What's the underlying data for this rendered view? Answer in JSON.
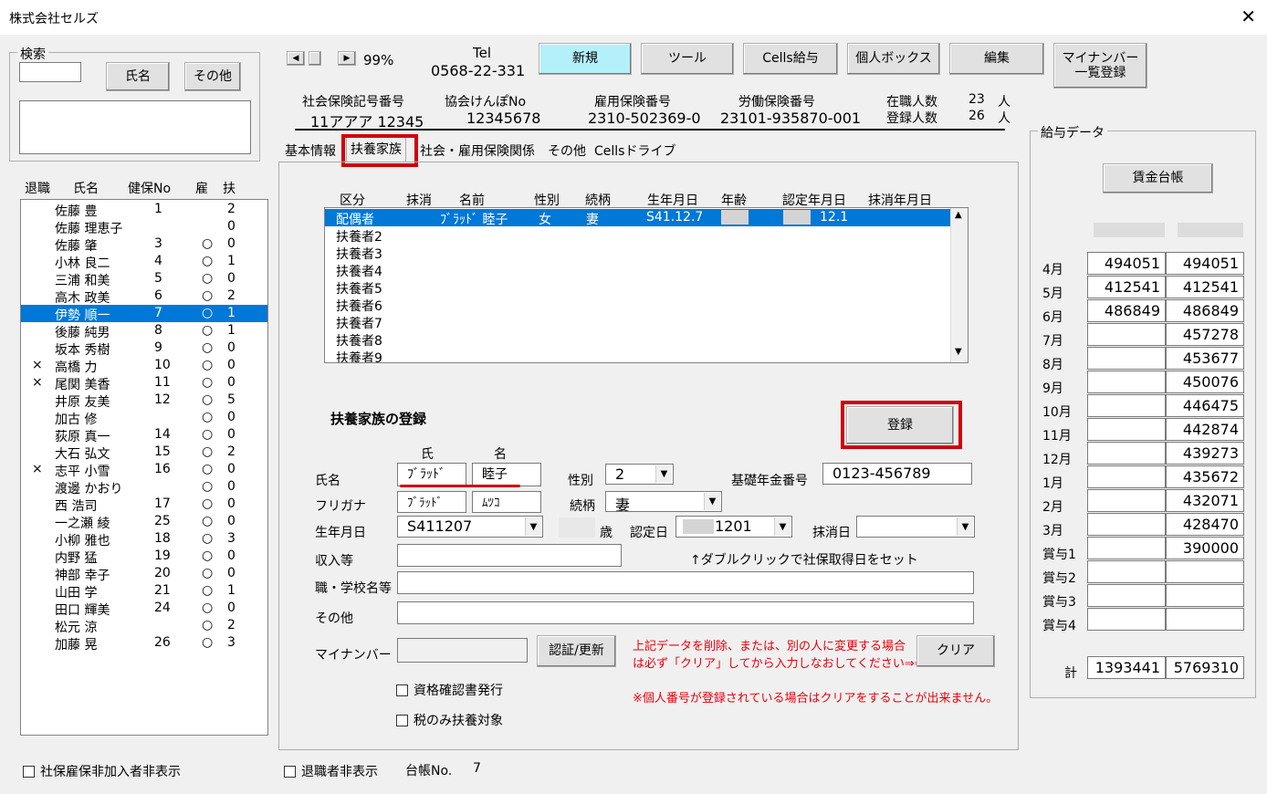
{
  "window": {
    "title": "株式会社セルズ"
  },
  "search": {
    "title": "検索",
    "name_btn": "氏名",
    "other_btn": "その他",
    "input_value": ""
  },
  "employee_list": {
    "headers": {
      "retired": "退職",
      "name": "氏名",
      "kenpo_no": "健保No",
      "employment": "雇",
      "dependents": "扶"
    },
    "rows": [
      {
        "retired": "",
        "name": "佐藤 豊",
        "kenpo_no": "1",
        "employment": "",
        "dependents": "2"
      },
      {
        "retired": "",
        "name": "佐藤 理恵子",
        "kenpo_no": "",
        "employment": "",
        "dependents": "0"
      },
      {
        "retired": "",
        "name": "佐藤 肇",
        "kenpo_no": "3",
        "employment": "○",
        "dependents": "0"
      },
      {
        "retired": "",
        "name": "小林 良二",
        "kenpo_no": "4",
        "employment": "○",
        "dependents": "1"
      },
      {
        "retired": "",
        "name": "三浦 和美",
        "kenpo_no": "5",
        "employment": "○",
        "dependents": "0"
      },
      {
        "retired": "",
        "name": "高木 政美",
        "kenpo_no": "6",
        "employment": "○",
        "dependents": "2"
      },
      {
        "retired": "",
        "name": "伊勢 順一",
        "kenpo_no": "7",
        "employment": "○",
        "dependents": "1"
      },
      {
        "retired": "",
        "name": "後藤 純男",
        "kenpo_no": "8",
        "employment": "○",
        "dependents": "1"
      },
      {
        "retired": "",
        "name": "坂本 秀樹",
        "kenpo_no": "9",
        "employment": "○",
        "dependents": "0"
      },
      {
        "retired": "×",
        "name": "高橋 力",
        "kenpo_no": "10",
        "employment": "○",
        "dependents": "0"
      },
      {
        "retired": "×",
        "name": "尾関 美香",
        "kenpo_no": "11",
        "employment": "○",
        "dependents": "0"
      },
      {
        "retired": "",
        "name": "井原 友美",
        "kenpo_no": "12",
        "employment": "○",
        "dependents": "5"
      },
      {
        "retired": "",
        "name": "加古 修",
        "kenpo_no": "",
        "employment": "○",
        "dependents": "0"
      },
      {
        "retired": "",
        "name": "荻原 真一",
        "kenpo_no": "14",
        "employment": "○",
        "dependents": "0"
      },
      {
        "retired": "",
        "name": "大石 弘文",
        "kenpo_no": "15",
        "employment": "○",
        "dependents": "2"
      },
      {
        "retired": "×",
        "name": "志平 小雪",
        "kenpo_no": "16",
        "employment": "○",
        "dependents": "0"
      },
      {
        "retired": "",
        "name": "渡邊 かおり",
        "kenpo_no": "",
        "employment": "○",
        "dependents": "0"
      },
      {
        "retired": "",
        "name": "西 浩司",
        "kenpo_no": "17",
        "employment": "○",
        "dependents": "0"
      },
      {
        "retired": "",
        "name": "一之瀬 綾",
        "kenpo_no": "25",
        "employment": "○",
        "dependents": "0"
      },
      {
        "retired": "",
        "name": "小柳 雅也",
        "kenpo_no": "18",
        "employment": "○",
        "dependents": "3"
      },
      {
        "retired": "",
        "name": "内野 猛",
        "kenpo_no": "19",
        "employment": "○",
        "dependents": "0"
      },
      {
        "retired": "",
        "name": "神部 幸子",
        "kenpo_no": "20",
        "employment": "○",
        "dependents": "0"
      },
      {
        "retired": "",
        "name": "山田 学",
        "kenpo_no": "21",
        "employment": "○",
        "dependents": "1"
      },
      {
        "retired": "",
        "name": "田口 輝美",
        "kenpo_no": "24",
        "employment": "○",
        "dependents": "0"
      },
      {
        "retired": "",
        "name": "松元 涼",
        "kenpo_no": "",
        "employment": "○",
        "dependents": "2"
      },
      {
        "retired": "",
        "name": "加藤 晃",
        "kenpo_no": "26",
        "employment": "○",
        "dependents": "3"
      }
    ],
    "selected_index": 6
  },
  "bottom": {
    "hide_uninsured": "社保雇保非加入者非表示",
    "hide_retired": "退職者非表示",
    "ledger_label": "台帳No.",
    "ledger_value": "7"
  },
  "toolbar": {
    "zoom": "99%",
    "tel_label": "Tel",
    "tel_value": "0568-22-331",
    "new_btn": "新規",
    "tool_btn": "ツール",
    "cells_kyuyo_btn": "Cells給与",
    "personal_box_btn": "個人ボックス",
    "edit_btn": "編集",
    "mynumber_btn_line1": "マイナンバー",
    "mynumber_btn_line2": "一覧登録"
  },
  "info": {
    "shaho_label": "社会保険記号番号",
    "shaho_value": "11アアア 12345",
    "kyokai_label": "協会けんぽNo",
    "kyokai_value": "12345678",
    "koyo_label": "雇用保険番号",
    "koyo_value": "2310-502369-0",
    "rodo_label": "労働保険番号",
    "rodo_value": "23101-935870-001",
    "zaishoku_label": "在職人数",
    "zaishoku_value": "23",
    "toroku_label": "登録人数",
    "toroku_value": "26",
    "unit": "人"
  },
  "tabs": [
    "基本情報",
    "扶養家族",
    "社会・雇用保険関係",
    "その他",
    "Cellsドライブ"
  ],
  "dependents_list": {
    "headers": [
      "区分",
      "抹消",
      "名前",
      "性別",
      "続柄",
      "生年月日",
      "年齢",
      "認定年月日",
      "抹消年月日"
    ],
    "rows": [
      {
        "kubun": "配偶者",
        "masho": "",
        "name": "ﾌﾞﾗｯﾄﾞ 睦子",
        "sex": "女",
        "relation": "妻",
        "birth": "S41.12.7",
        "age": "",
        "nintei": "12.1",
        "massho_date": ""
      },
      {
        "kubun": "扶養者2"
      },
      {
        "kubun": "扶養者3"
      },
      {
        "kubun": "扶養者4"
      },
      {
        "kubun": "扶養者5"
      },
      {
        "kubun": "扶養者6"
      },
      {
        "kubun": "扶養者7"
      },
      {
        "kubun": "扶養者8"
      },
      {
        "kubun": "扶養者9"
      }
    ]
  },
  "form": {
    "section_title": "扶養家族の登録",
    "register_btn": "登録",
    "sei_label": "氏",
    "mei_label": "名",
    "name_label": "氏名",
    "name_sei": "ﾌﾞﾗｯﾄﾞ",
    "name_mei": "睦子",
    "furigana_label": "フリガナ",
    "furigana_sei": "ﾌﾞﾗｯﾄﾞ",
    "furigana_mei": "ﾑﾂｺ",
    "sex_label": "性別",
    "sex_value": "2",
    "relation_label": "続柄",
    "relation_value": "妻",
    "pension_label": "基礎年金番号",
    "pension_value": "0123-456789",
    "birth_label": "生年月日",
    "birth_value": "S411207",
    "age_unit": "歳",
    "nintei_label": "認定日",
    "nintei_value": "1201",
    "massho_label": "抹消日",
    "massho_value": "",
    "income_label": "収入等",
    "income_value": "",
    "dblclick_hint": "↑ダブルクリックで社保取得日をセット",
    "school_label": "職・学校名等",
    "school_value": "",
    "other_label": "その他",
    "other_value": "",
    "mynumber_label": "マイナンバー",
    "mynumber_value": "",
    "auth_btn": "認証/更新",
    "warning_line1": "上記データを削除、または、別の人に変更する場合",
    "warning_line2": "は必ず「クリア」してから入力しなおしてください⇒⇒",
    "clear_btn": "クリア",
    "cert_check": "資格確認書発行",
    "tax_check": "税のみ扶養対象",
    "note": "※個人番号が登録されている場合はクリアをすることが出来ません。"
  },
  "salary": {
    "title": "給与データ",
    "ledger_btn": "賃金台帳",
    "rows": [
      {
        "label": "4月",
        "a": "494051",
        "b": "494051"
      },
      {
        "label": "5月",
        "a": "412541",
        "b": "412541"
      },
      {
        "label": "6月",
        "a": "486849",
        "b": "486849"
      },
      {
        "label": "7月",
        "a": "",
        "b": "457278"
      },
      {
        "label": "8月",
        "a": "",
        "b": "453677"
      },
      {
        "label": "9月",
        "a": "",
        "b": "450076"
      },
      {
        "label": "10月",
        "a": "",
        "b": "446475"
      },
      {
        "label": "11月",
        "a": "",
        "b": "442874"
      },
      {
        "label": "12月",
        "a": "",
        "b": "439273"
      },
      {
        "label": "1月",
        "a": "",
        "b": "435672"
      },
      {
        "label": "2月",
        "a": "",
        "b": "432071"
      },
      {
        "label": "3月",
        "a": "",
        "b": "428470"
      },
      {
        "label": "賞与1",
        "a": "",
        "b": "390000"
      },
      {
        "label": "賞与2",
        "a": "",
        "b": ""
      },
      {
        "label": "賞与3",
        "a": "",
        "b": ""
      },
      {
        "label": "賞与4",
        "a": "",
        "b": ""
      }
    ],
    "total_label": "計",
    "total_a": "1393441",
    "total_b": "5769310"
  }
}
